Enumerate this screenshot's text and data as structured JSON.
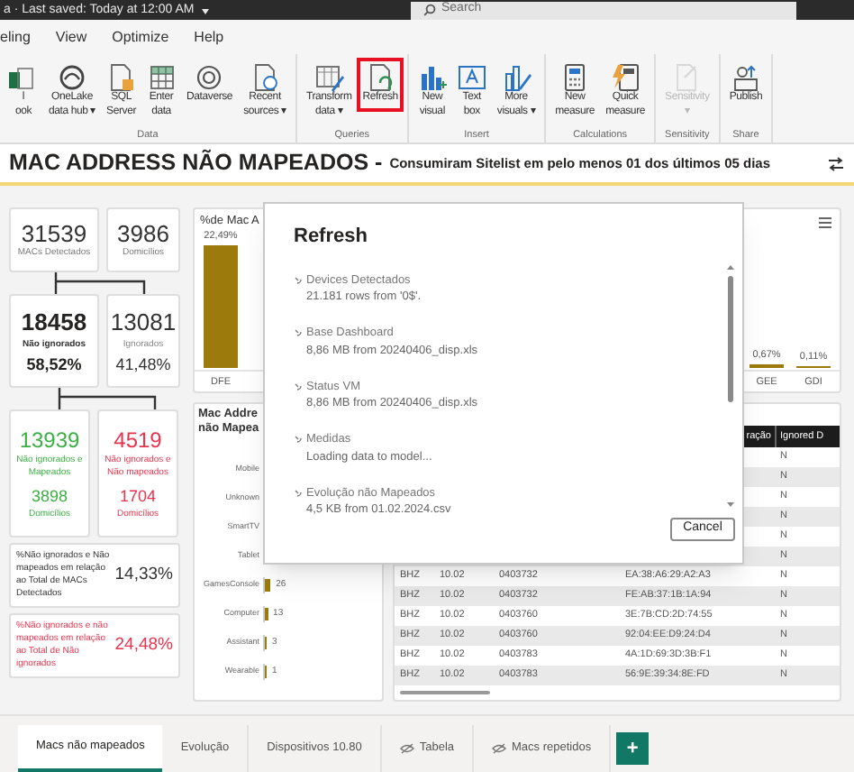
{
  "title_bar": {
    "saved_text": "a · Last saved: Today at 12:00 AM",
    "search": {
      "placeholder": "Search"
    }
  },
  "menu": [
    "eling",
    "View",
    "Optimize",
    "Help"
  ],
  "ribbon": [
    {
      "label": "Data",
      "buttons": [
        {
          "lines": [
            "l",
            "ook"
          ],
          "kind": "excel",
          "highlighted": false,
          "disabled": false
        },
        {
          "lines": [
            "OneLake",
            "data hub ▾"
          ],
          "kind": "onelake",
          "highlighted": false,
          "disabled": false
        },
        {
          "lines": [
            "SQL",
            "Server"
          ],
          "kind": "doc",
          "highlighted": false,
          "disabled": false
        },
        {
          "lines": [
            "Enter",
            "data"
          ],
          "kind": "grid",
          "highlighted": false,
          "disabled": false
        },
        {
          "lines": [
            "Dataverse"
          ],
          "kind": "swirl",
          "highlighted": false,
          "disabled": false
        },
        {
          "lines": [
            "Recent",
            "sources ▾"
          ],
          "kind": "recent",
          "highlighted": false,
          "disabled": false
        }
      ]
    },
    {
      "label": "Queries",
      "buttons": [
        {
          "lines": [
            "Transform",
            "data ▾"
          ],
          "kind": "transform",
          "highlighted": false,
          "disabled": false
        },
        {
          "lines": [
            "Refresh"
          ],
          "kind": "refresh",
          "highlighted": true,
          "disabled": false
        }
      ]
    },
    {
      "label": "Insert",
      "buttons": [
        {
          "lines": [
            "New",
            "visual"
          ],
          "kind": "bars",
          "highlighted": false,
          "disabled": false
        },
        {
          "lines": [
            "Text",
            "box"
          ],
          "kind": "textbox",
          "highlighted": false,
          "disabled": false
        },
        {
          "lines": [
            "More",
            "visuals ▾"
          ],
          "kind": "visuals",
          "highlighted": false,
          "disabled": false
        }
      ]
    },
    {
      "label": "Calculations",
      "buttons": [
        {
          "lines": [
            "New",
            "measure"
          ],
          "kind": "calc",
          "highlighted": false,
          "disabled": false
        },
        {
          "lines": [
            "Quick",
            "measure"
          ],
          "kind": "quick",
          "highlighted": false,
          "disabled": false
        }
      ]
    },
    {
      "label": "Sensitivity",
      "buttons": [
        {
          "lines": [
            "Sensitivity",
            "▾"
          ],
          "kind": "sensitivity",
          "highlighted": false,
          "disabled": true
        }
      ]
    },
    {
      "label": "Share",
      "buttons": [
        {
          "lines": [
            "Publish"
          ],
          "kind": "publish",
          "highlighted": false,
          "disabled": false
        }
      ]
    }
  ],
  "page_title": "MAC ADDRESS NÃO MAPEADOS -",
  "page_subtitle": "Consumiram Sitelist em pelo menos 01 dos últimos 05 dias",
  "top_cards": [
    {
      "value": "31539",
      "label": "MACs Detectados"
    },
    {
      "value": "3986",
      "label": "Domicílios"
    }
  ],
  "mid_cards": [
    {
      "value": "18458",
      "label": "Não ignorados",
      "percent": "58,52%",
      "emphasis": true
    },
    {
      "value": "13081",
      "label": "Ignorados",
      "percent": "41,48%",
      "emphasis": false
    }
  ],
  "split_cards": [
    {
      "value": "13939",
      "label": "Não ignorados e Mapeados",
      "sub_value": "3898",
      "sub_label": "Domicílios",
      "color": "#3cb043"
    },
    {
      "value": "4519",
      "label": "Não ignorados e Não mapeados",
      "sub_value": "1704",
      "sub_label": "Domicílios",
      "color": "#e8344e"
    }
  ],
  "ratio_cards": [
    {
      "text": "%Não ignorados e Não mapeados em relação ao Total de MACs Detectados",
      "value": "14,33%",
      "color": "#333333"
    },
    {
      "text": "%Não ignorados e não mapeados em relação ao Total de Não ignorados",
      "value": "24,48%",
      "color": "#e8344e"
    }
  ],
  "percent_chart": {
    "chart_data": {
      "type": "bar",
      "title": "%de Mac A",
      "categories": [
        "DFE",
        "GEE",
        "GDI"
      ],
      "values": [
        22.49,
        0.67,
        0.11
      ],
      "value_labels": [
        "22,49%",
        "0,67%",
        "0,11%"
      ]
    }
  },
  "device_chart": {
    "title_lines": [
      "Mac Addre",
      "não Mapea"
    ],
    "rows": [
      {
        "label": "Mobile"
      },
      {
        "label": "Unknown"
      },
      {
        "label": "SmartTV"
      },
      {
        "label": "Tablet"
      },
      {
        "label": "GamesConsole",
        "value": "26"
      },
      {
        "label": "Computer",
        "value": "13"
      },
      {
        "label": "Assistant",
        "value": "3"
      },
      {
        "label": "Wearable",
        "value": "1"
      }
    ]
  },
  "table": {
    "columns": [
      "ração",
      "Ignored D"
    ],
    "rows": [
      {
        "ignored": "N"
      },
      {
        "ignored": "N"
      },
      {
        "ignored": "N"
      },
      {
        "ignored": "N"
      },
      {
        "ignored": "N"
      },
      {
        "ignored": "N"
      },
      {
        "region": "BHZ",
        "code": "10.02",
        "device": "0403732",
        "mac": "EA:38:A6:29:A2:A3",
        "ignored": "N"
      },
      {
        "region": "BHZ",
        "code": "10.02",
        "device": "0403732",
        "mac": "FE:AB:37:1B:1A:94",
        "ignored": "N"
      },
      {
        "region": "BHZ",
        "code": "10.02",
        "device": "0403760",
        "mac": "3E:7B:CD:2D:74:55",
        "ignored": "N"
      },
      {
        "region": "BHZ",
        "code": "10.02",
        "device": "0403760",
        "mac": "92:04:EE:D9:24:D4",
        "ignored": "N"
      },
      {
        "region": "BHZ",
        "code": "10.02",
        "device": "0403783",
        "mac": "4A:1D:69:3D:3B:F1",
        "ignored": "N"
      },
      {
        "region": "BHZ",
        "code": "10.02",
        "device": "0403783",
        "mac": "56:9E:39:34:8E:FD",
        "ignored": "N"
      }
    ]
  },
  "dialog": {
    "title": "Refresh",
    "items": [
      {
        "name": "Devices Detectados",
        "detail": "21.181 rows from '0$'."
      },
      {
        "name": "Base Dashboard",
        "detail": "8,86 MB from 20240406_disp.xls"
      },
      {
        "name": "Status VM",
        "detail": "8,86 MB from 20240406_disp.xls"
      },
      {
        "name": "Medidas",
        "detail": "Loading data to model..."
      },
      {
        "name": "Evolução não Mapeados",
        "detail": "4,5 KB from 01.02.2024.csv"
      }
    ],
    "cancel": "Cancel"
  },
  "page_tabs": [
    {
      "label": "Macs não mapeados",
      "selected": true,
      "hidden": false
    },
    {
      "label": "Evolução",
      "selected": false,
      "hidden": false
    },
    {
      "label": "Dispositivos 10.80",
      "selected": false,
      "hidden": false
    },
    {
      "label": "Tabela",
      "selected": false,
      "hidden": true
    },
    {
      "label": "Macs repetidos",
      "selected": false,
      "hidden": true
    }
  ],
  "add_page": "+"
}
